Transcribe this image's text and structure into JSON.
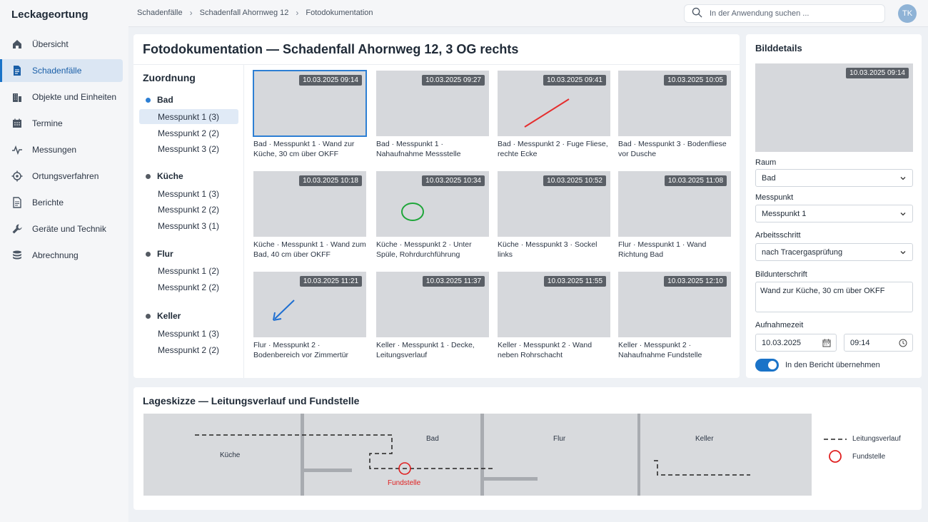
{
  "app": {
    "title": "Leckageortung"
  },
  "sidebar": {
    "items": [
      {
        "label": "Übersicht",
        "icon": "home-icon",
        "active": false
      },
      {
        "label": "Schadenfälle",
        "icon": "document-icon",
        "active": true
      },
      {
        "label": "Objekte und Einheiten",
        "icon": "building-icon",
        "active": false
      },
      {
        "label": "Termine",
        "icon": "calendar-icon",
        "active": false
      },
      {
        "label": "Messungen",
        "icon": "pulse-icon",
        "active": false
      },
      {
        "label": "Ortungsverfahren",
        "icon": "crosshair-icon",
        "active": false
      },
      {
        "label": "Berichte",
        "icon": "report-icon",
        "active": false
      },
      {
        "label": "Geräte und Technik",
        "icon": "wrench-icon",
        "active": false
      },
      {
        "label": "Abrechnung",
        "icon": "coins-icon",
        "active": false
      }
    ]
  },
  "topbar": {
    "breadcrumb": [
      "Schadenfälle",
      "Schadenfall Ahornweg 12",
      "Fotodokumentation"
    ],
    "search_placeholder": "In der Anwendung suchen ...",
    "avatar": "TK"
  },
  "main": {
    "title": "Fotodokumentation — Schadenfall Ahornweg 12, 3 OG rechts",
    "assignment": {
      "title": "Zuordnung",
      "groups": [
        {
          "name": "Bad",
          "color": "#2d7fd4",
          "items": [
            "Messpunkt 1 (3)",
            "Messpunkt 2 (2)",
            "Messpunkt 3 (2)"
          ]
        },
        {
          "name": "Küche",
          "color": "#555b63",
          "items": [
            "Messpunkt 1 (3)",
            "Messpunkt 2 (2)",
            "Messpunkt 3 (1)"
          ]
        },
        {
          "name": "Flur",
          "color": "#555b63",
          "items": [
            "Messpunkt 1 (2)",
            "Messpunkt 2 (2)"
          ]
        },
        {
          "name": "Keller",
          "color": "#555b63",
          "items": [
            "Messpunkt 1 (3)",
            "Messpunkt 2 (2)"
          ]
        }
      ]
    },
    "photos": [
      {
        "time": "10.03.2025 09:14",
        "caption": "Bad · Messpunkt 1 · Wand zur Küche, 30 cm über OKFF",
        "mark": "none",
        "selected": true
      },
      {
        "time": "10.03.2025 09:27",
        "caption": "Bad · Messpunkt 1 · Nahaufnahme Messstelle",
        "mark": "none",
        "selected": false
      },
      {
        "time": "10.03.2025 09:41",
        "caption": "Bad · Messpunkt 2 · Fuge Fliese, rechte Ecke",
        "mark": "red-line",
        "selected": false
      },
      {
        "time": "10.03.2025 10:05",
        "caption": "Bad · Messpunkt 3 · Bodenfliese vor Dusche",
        "mark": "none",
        "selected": false
      },
      {
        "time": "10.03.2025 10:18",
        "caption": "Küche · Messpunkt 1 · Wand zum Bad, 40 cm über OKFF",
        "mark": "none",
        "selected": false
      },
      {
        "time": "10.03.2025 10:34",
        "caption": "Küche · Messpunkt 2 · Unter Spüle, Rohrdurchführung",
        "mark": "green-circle",
        "selected": false
      },
      {
        "time": "10.03.2025 10:52",
        "caption": "Küche · Messpunkt 3 · Sockel links",
        "mark": "none",
        "selected": false
      },
      {
        "time": "10.03.2025 11:08",
        "caption": "Flur · Messpunkt 1 · Wand Richtung Bad",
        "mark": "none",
        "selected": false
      },
      {
        "time": "10.03.2025 11:21",
        "caption": "Flur · Messpunkt 2 · Bodenbereich vor Zimmertür",
        "mark": "blue-arrow",
        "selected": false
      },
      {
        "time": "10.03.2025 11:37",
        "caption": "Keller · Messpunkt 1 · Decke, Leitungsverlauf",
        "mark": "none",
        "selected": false
      },
      {
        "time": "10.03.2025 11:55",
        "caption": "Keller · Messpunkt 2 · Wand neben Rohrschacht",
        "mark": "none",
        "selected": false
      },
      {
        "time": "10.03.2025 12:10",
        "caption": "Keller · Messpunkt 2 · Nahaufnahme Fundstelle",
        "mark": "none",
        "selected": false
      }
    ]
  },
  "details": {
    "title": "Bilddetails",
    "image_time": "10.03.2025 09:14",
    "room_label": "Raum",
    "room_value": "Bad",
    "point_label": "Messpunkt",
    "point_value": "Messpunkt 1",
    "step_label": "Arbeitsschritt",
    "step_value": "nach Tracergasprüfung",
    "caption_label": "Bildunterschrift",
    "caption_value": "Wand zur Küche, 30 cm über OKFF",
    "time_label": "Aufnahmezeit",
    "date_value": "10.03.2025",
    "clock_value": "09:14",
    "toggle_label": "In den Bericht übernehmen",
    "toggle_on": true
  },
  "sketch": {
    "title": "Lageskizze — Leitungsverlauf und Fundstelle",
    "rooms": [
      "Küche",
      "Bad",
      "Flur",
      "Keller"
    ],
    "find_label": "Fundstelle",
    "legend_line": "Leitungsverlauf",
    "legend_find": "Fundstelle",
    "colors": {
      "find": "#e02020",
      "line": "#222222"
    }
  }
}
